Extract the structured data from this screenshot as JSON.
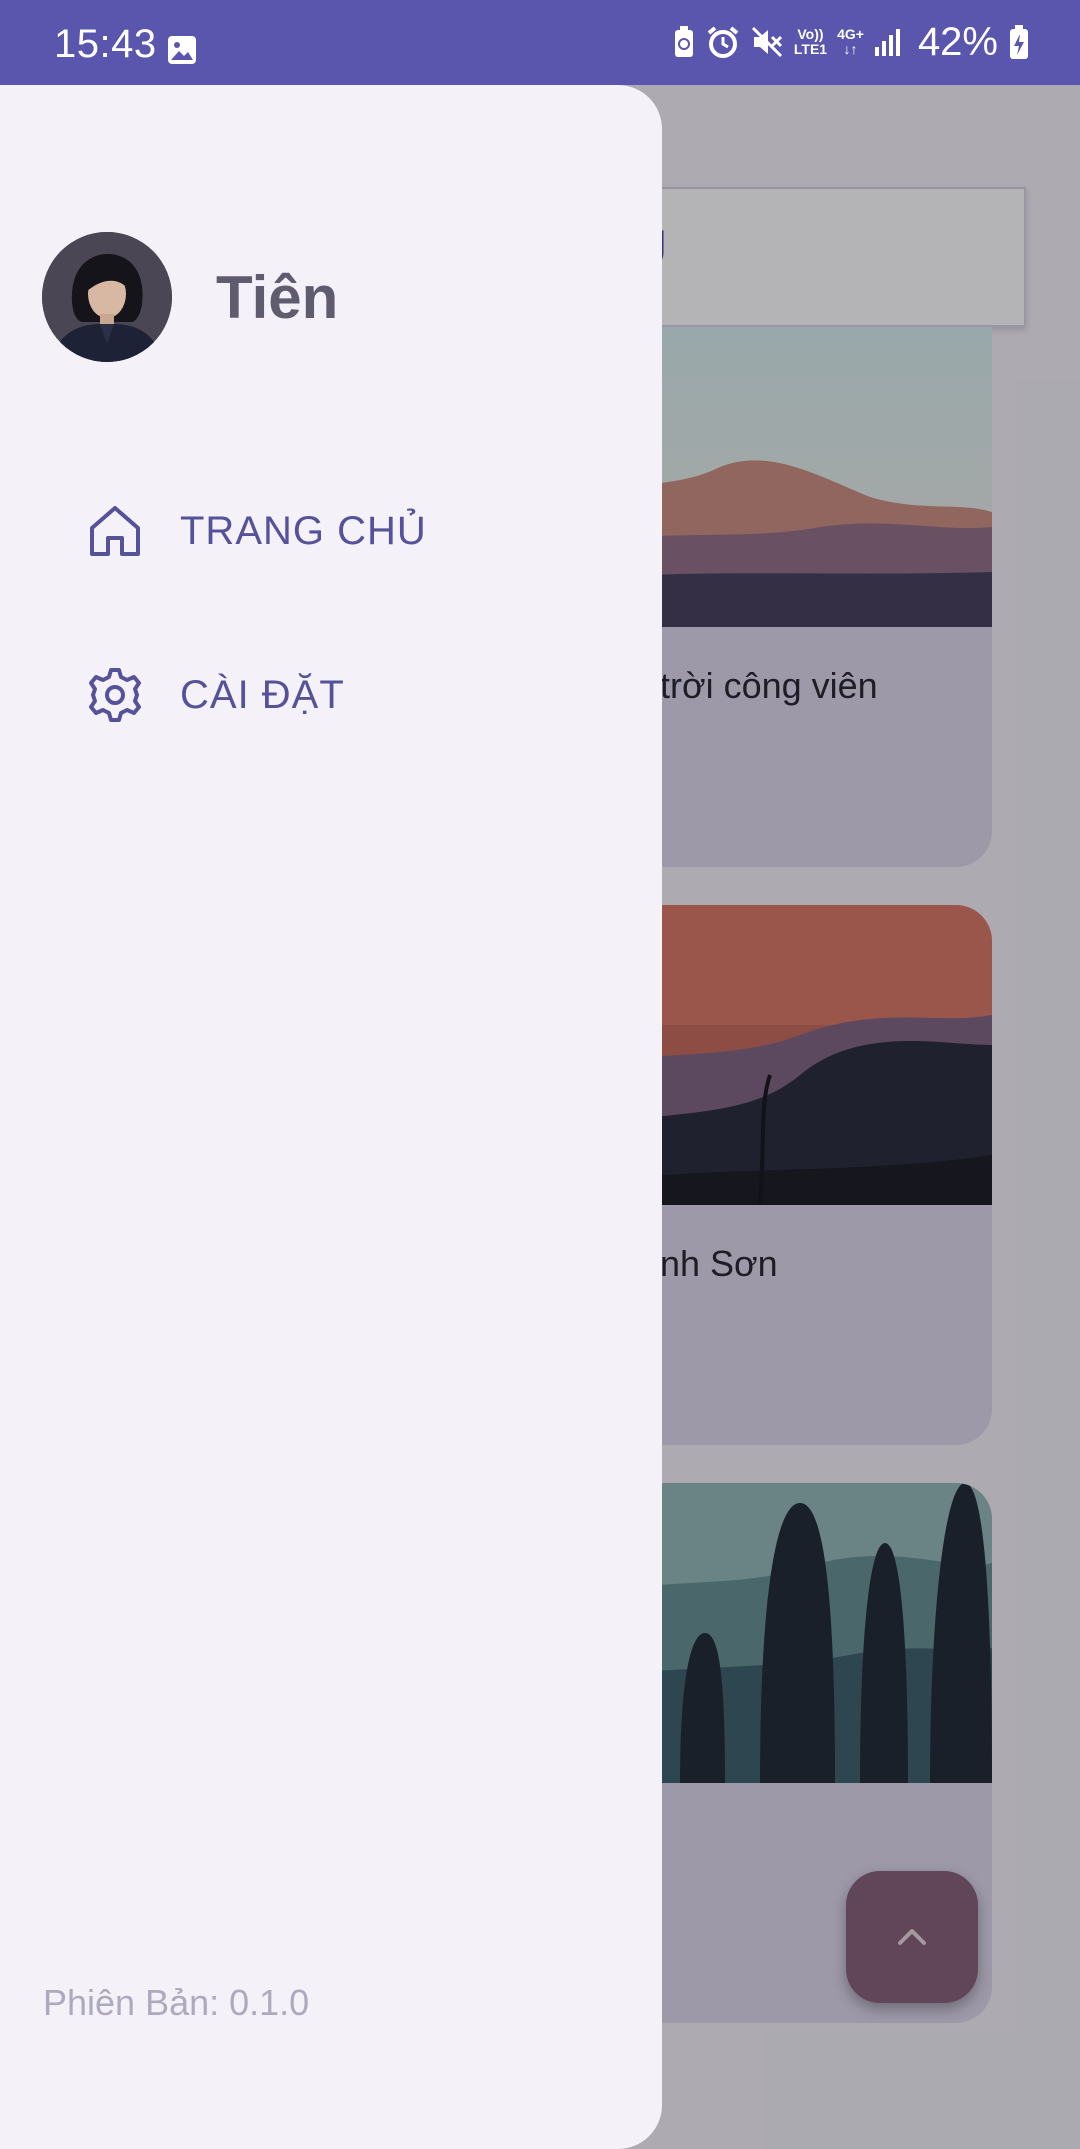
{
  "status_bar": {
    "time": "15:43",
    "network_top": "Vo))",
    "network_bottom": "LTE1",
    "network_type": "4G+",
    "battery_percent": "42%"
  },
  "background": {
    "search_text_fragment": "Ủ",
    "cards": [
      {
        "title_fragment": "trời công viên"
      },
      {
        "title_fragment": "nh Sơn"
      },
      {
        "title_fragment": ""
      }
    ]
  },
  "drawer": {
    "user_name": "Tiên",
    "nav": [
      {
        "label": "TRANG CHỦ",
        "icon": "home-icon"
      },
      {
        "label": "CÀI ĐẶT",
        "icon": "gear-icon"
      }
    ],
    "version": "Phiên Bản: 0.1.0"
  },
  "colors": {
    "status_bar": "#5a56ad",
    "accent": "#565299",
    "drawer_bg": "#f4f1f8",
    "fab": "#825a73"
  }
}
